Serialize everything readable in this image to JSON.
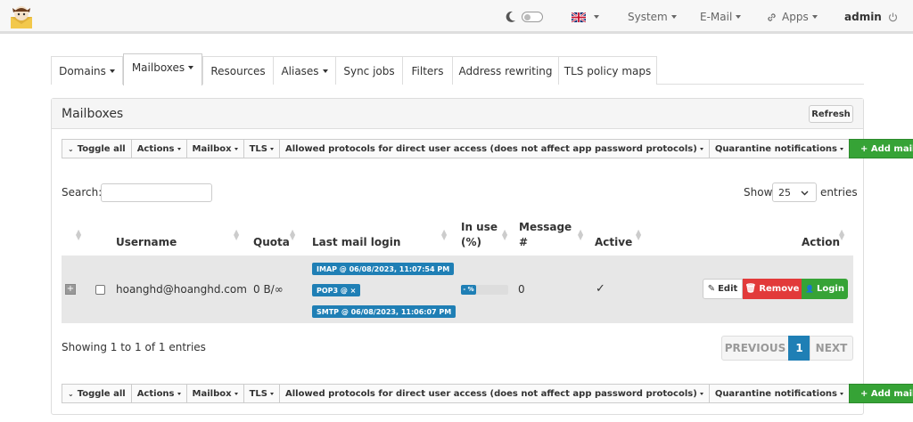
{
  "nav": {
    "language": "",
    "system": "System",
    "email": "E-Mail",
    "apps": "Apps",
    "user": "admin"
  },
  "tabs": [
    {
      "label": "Domains",
      "dropdown": true
    },
    {
      "label": "Mailboxes",
      "dropdown": true,
      "active": true
    },
    {
      "label": "Resources",
      "dropdown": false
    },
    {
      "label": "Aliases",
      "dropdown": true
    },
    {
      "label": "Sync jobs",
      "dropdown": false
    },
    {
      "label": "Filters",
      "dropdown": false
    },
    {
      "label": "Address rewriting",
      "dropdown": false
    },
    {
      "label": "TLS policy maps",
      "dropdown": false
    }
  ],
  "panel": {
    "title": "Mailboxes",
    "refresh": "Refresh"
  },
  "toolbar": {
    "toggle_all": "Toggle all",
    "actions": "Actions",
    "mailbox": "Mailbox",
    "tls": "TLS",
    "allowed_protocols": "Allowed protocols for direct user access (does not affect app password protocols)",
    "quarantine": "Quarantine notifications",
    "add_mailbox": "+ Add mailbox"
  },
  "table_controls": {
    "search_label": "Search:",
    "search_value": "",
    "show_label": "Show",
    "page_size": "25",
    "entries_label": "entries"
  },
  "columns": {
    "username": "Username",
    "quota": "Quota",
    "last_login": "Last mail login",
    "in_use_1": "In use",
    "in_use_2": "(%)",
    "message_1": "Message",
    "message_2": "#",
    "active": "Active",
    "action": "Action"
  },
  "rows": [
    {
      "username": "hoanghd@hoanghd.com",
      "quota": "0 B/∞",
      "imap": "IMAP @ 06/08/2023, 11:07:54 PM",
      "pop3": "POP3 @ ×",
      "smtp": "SMTP @ 06/08/2023, 11:06:07 PM",
      "in_use_label": "- %",
      "messages": "0",
      "active": "✓",
      "edit": "Edit",
      "remove": "Remove",
      "login": "Login"
    }
  ],
  "footer": {
    "showing": "Showing 1 to 1 of 1 entries",
    "previous": "PREVIOUS",
    "page": "1",
    "next": "NEXT"
  },
  "colors": {
    "badge": "#1f7fb5",
    "green": "#36a336",
    "red": "#e23a3a"
  }
}
